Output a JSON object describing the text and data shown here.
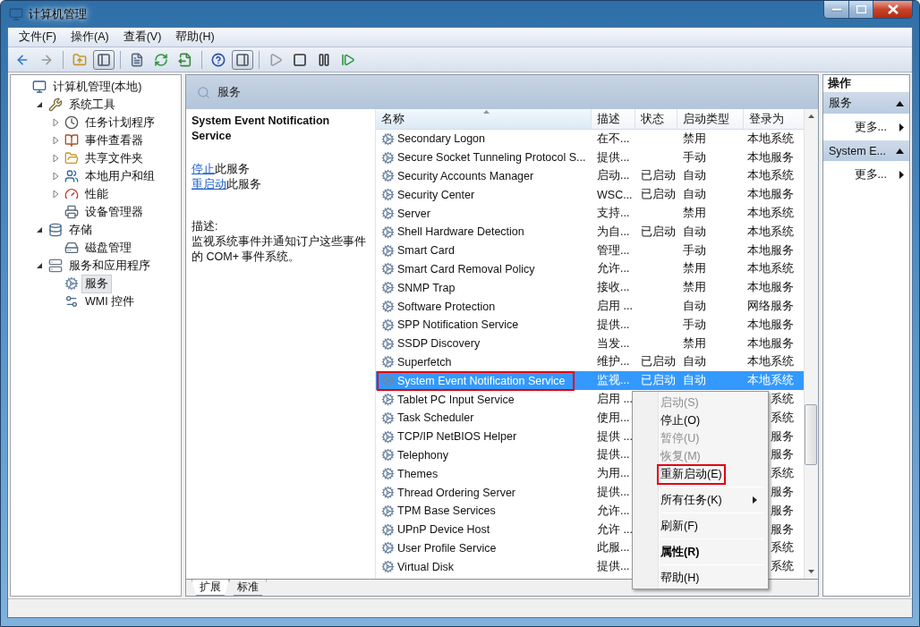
{
  "window": {
    "title": "计算机管理"
  },
  "menu": [
    "文件(F)",
    "操作(A)",
    "查看(V)",
    "帮助(H)"
  ],
  "toolbar": [
    {
      "kind": "back",
      "disabled": false,
      "pressed": false
    },
    {
      "kind": "forward",
      "disabled": true,
      "pressed": false
    },
    {
      "kind": "up",
      "disabled": false,
      "pressed": false
    },
    {
      "kind": "tree",
      "disabled": false,
      "pressed": true
    },
    {
      "kind": "properties",
      "disabled": false,
      "pressed": false
    },
    {
      "kind": "refresh",
      "disabled": false,
      "pressed": false
    },
    {
      "kind": "export",
      "disabled": false,
      "pressed": false
    },
    {
      "kind": "help",
      "disabled": false,
      "pressed": false
    },
    {
      "kind": "actionpane",
      "disabled": false,
      "pressed": true
    },
    {
      "kind": "start",
      "disabled": true,
      "pressed": false
    },
    {
      "kind": "stop",
      "disabled": false,
      "pressed": false
    },
    {
      "kind": "pause",
      "disabled": false,
      "pressed": false
    },
    {
      "kind": "resume",
      "disabled": false,
      "pressed": false
    }
  ],
  "tree": [
    {
      "label": "计算机管理(本地)",
      "kind": "computer",
      "selected": false,
      "children": [
        {
          "label": "系统工具",
          "kind": "tools",
          "selected": false,
          "expanded": true,
          "children": [
            {
              "label": "任务计划程序",
              "kind": "clock",
              "selected": false,
              "expanded": false
            },
            {
              "label": "事件查看器",
              "kind": "book",
              "selected": false,
              "expanded": false
            },
            {
              "label": "共享文件夹",
              "kind": "folder",
              "selected": false,
              "expanded": false
            },
            {
              "label": "本地用户和组",
              "kind": "users",
              "selected": false,
              "expanded": false
            },
            {
              "label": "性能",
              "kind": "gauge",
              "selected": false,
              "expanded": false
            },
            {
              "label": "设备管理器",
              "kind": "device",
              "selected": false
            }
          ]
        },
        {
          "label": "存储",
          "kind": "storage",
          "selected": false,
          "expanded": true,
          "children": [
            {
              "label": "磁盘管理",
              "kind": "disk",
              "selected": false
            }
          ]
        },
        {
          "label": "服务和应用程序",
          "kind": "server",
          "selected": false,
          "expanded": true,
          "children": [
            {
              "label": "服务",
              "kind": "gear",
              "selected": true
            },
            {
              "label": "WMI 控件",
              "kind": "wmi",
              "selected": false
            }
          ]
        }
      ]
    }
  ],
  "center": {
    "title": "服务",
    "details": {
      "title": "System Event Notification Service",
      "actions": [
        {
          "link": "停止",
          "text": "此服务"
        },
        {
          "link": "重启动",
          "text": "此服务"
        }
      ],
      "description_label": "描述:",
      "description": "监视系统事件并通知订户这些事件的 COM+ 事件系统。"
    },
    "columns": [
      {
        "label": "名称",
        "sorted": true
      },
      {
        "label": "描述",
        "sorted": false
      },
      {
        "label": "状态",
        "sorted": false
      },
      {
        "label": "启动类型",
        "sorted": false
      },
      {
        "label": "登录为",
        "sorted": false
      }
    ],
    "rows": [
      {
        "name": "Secondary Logon",
        "description": "在不...",
        "startup": "禁用",
        "logon": "本地系统",
        "selected": false,
        "highlighted": false
      },
      {
        "name": "Secure Socket Tunneling Protocol S...",
        "description": "提供...",
        "startup": "手动",
        "logon": "本地服务",
        "selected": false,
        "highlighted": false
      },
      {
        "name": "Security Accounts Manager",
        "description": "启动...",
        "status": "已启动",
        "startup": "自动",
        "logon": "本地系统",
        "selected": false,
        "highlighted": false
      },
      {
        "name": "Security Center",
        "description": "WSC...",
        "status": "已启动",
        "startup": "自动",
        "logon": "本地服务",
        "selected": false,
        "highlighted": false
      },
      {
        "name": "Server",
        "description": "支持...",
        "startup": "禁用",
        "logon": "本地系统",
        "selected": false,
        "highlighted": false
      },
      {
        "name": "Shell Hardware Detection",
        "description": "为自...",
        "status": "已启动",
        "startup": "自动",
        "logon": "本地系统",
        "selected": false,
        "highlighted": false
      },
      {
        "name": "Smart Card",
        "description": "管理...",
        "startup": "手动",
        "logon": "本地服务",
        "selected": false,
        "highlighted": false
      },
      {
        "name": "Smart Card Removal Policy",
        "description": "允许...",
        "startup": "禁用",
        "logon": "本地系统",
        "selected": false,
        "highlighted": false
      },
      {
        "name": "SNMP Trap",
        "description": "接收...",
        "startup": "禁用",
        "logon": "本地服务",
        "selected": false,
        "highlighted": false
      },
      {
        "name": "Software Protection",
        "description": "启用 ...",
        "startup": "自动",
        "logon": "网络服务",
        "selected": false,
        "highlighted": false
      },
      {
        "name": "SPP Notification Service",
        "description": "提供...",
        "startup": "手动",
        "logon": "本地服务",
        "selected": false,
        "highlighted": false
      },
      {
        "name": "SSDP Discovery",
        "description": "当发...",
        "startup": "禁用",
        "logon": "本地服务",
        "selected": false,
        "highlighted": false
      },
      {
        "name": "Superfetch",
        "description": "维护...",
        "status": "已启动",
        "startup": "自动",
        "logon": "本地系统",
        "selected": false,
        "highlighted": false
      },
      {
        "name": "System Event Notification Service",
        "description": "监视...",
        "status": "已启动",
        "startup": "自动",
        "logon": "本地系统",
        "selected": true,
        "highlighted": true
      },
      {
        "name": "Tablet PC Input Service",
        "description": "启用 ...",
        "logon": "系统",
        "selected": false,
        "highlighted": false
      },
      {
        "name": "Task Scheduler",
        "description": "使用...",
        "logon": "系统",
        "selected": false,
        "highlighted": false
      },
      {
        "name": "TCP/IP NetBIOS Helper",
        "description": "提供 ...",
        "logon": "服务",
        "selected": false,
        "highlighted": false
      },
      {
        "name": "Telephony",
        "description": "提供...",
        "logon": "服务",
        "selected": false,
        "highlighted": false
      },
      {
        "name": "Themes",
        "description": "为用...",
        "logon": "系统",
        "selected": false,
        "highlighted": false
      },
      {
        "name": "Thread Ordering Server",
        "description": "提供...",
        "logon": "服务",
        "selected": false,
        "highlighted": false
      },
      {
        "name": "TPM Base Services",
        "description": "允许...",
        "logon": "服务",
        "selected": false,
        "highlighted": false
      },
      {
        "name": "UPnP Device Host",
        "description": "允许 ...",
        "logon": "服务",
        "selected": false,
        "highlighted": false
      },
      {
        "name": "User Profile Service",
        "description": "此服...",
        "logon": "系统",
        "selected": false,
        "highlighted": false
      },
      {
        "name": "Virtual Disk",
        "description": "提供...",
        "logon": "系统",
        "selected": false,
        "highlighted": false
      }
    ],
    "tabs": [
      {
        "label": "扩展",
        "selected": true
      },
      {
        "label": "标准",
        "selected": false
      }
    ]
  },
  "context_menu": [
    {
      "kind": "item",
      "label": "启动(S)",
      "disabled": true,
      "highlighted": false,
      "default": false,
      "submenu": false
    },
    {
      "kind": "item",
      "label": "停止(O)",
      "disabled": false,
      "highlighted": false,
      "default": false,
      "submenu": false
    },
    {
      "kind": "item",
      "label": "暂停(U)",
      "disabled": true,
      "highlighted": false,
      "default": false,
      "submenu": false
    },
    {
      "kind": "item",
      "label": "恢复(M)",
      "disabled": true,
      "highlighted": false,
      "default": false,
      "submenu": false
    },
    {
      "kind": "item",
      "label": "重新启动(E)",
      "disabled": false,
      "highlighted": true,
      "default": false,
      "submenu": false
    },
    {
      "kind": "separator"
    },
    {
      "kind": "item",
      "label": "所有任务(K)",
      "disabled": false,
      "highlighted": false,
      "default": false,
      "submenu": true
    },
    {
      "kind": "separator"
    },
    {
      "kind": "item",
      "label": "刷新(F)",
      "disabled": false,
      "highlighted": false,
      "default": false,
      "submenu": false
    },
    {
      "kind": "separator"
    },
    {
      "kind": "item",
      "label": "属性(R)",
      "disabled": false,
      "highlighted": false,
      "default": true,
      "submenu": false
    },
    {
      "kind": "separator"
    },
    {
      "kind": "item",
      "label": "帮助(H)",
      "disabled": false,
      "highlighted": false,
      "default": false,
      "submenu": false
    }
  ],
  "actions": {
    "title": "操作",
    "sections": [
      {
        "title": "服务",
        "expanded": true,
        "items": [
          "更多..."
        ]
      },
      {
        "title": "System E...",
        "expanded": true,
        "items": [
          "更多..."
        ]
      }
    ]
  }
}
